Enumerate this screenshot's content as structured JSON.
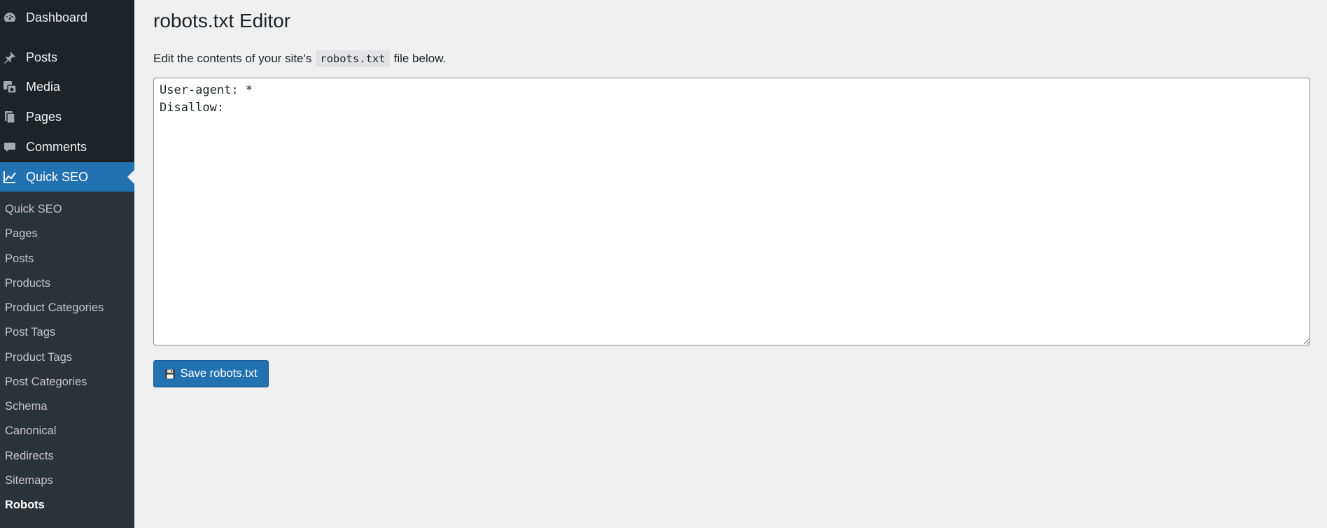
{
  "sidebar": {
    "menu": [
      {
        "label": "Dashboard",
        "icon": "dashboard-icon"
      },
      {
        "label": "Posts",
        "icon": "pin-icon"
      },
      {
        "label": "Media",
        "icon": "media-icon"
      },
      {
        "label": "Pages",
        "icon": "pages-icon"
      },
      {
        "label": "Comments",
        "icon": "comment-icon"
      },
      {
        "label": "Quick SEO",
        "icon": "chart-line-icon",
        "current": true
      }
    ],
    "submenu": [
      "Quick SEO",
      "Pages",
      "Posts",
      "Products",
      "Product Categories",
      "Post Tags",
      "Product Tags",
      "Post Categories",
      "Schema",
      "Canonical",
      "Redirects",
      "Sitemaps",
      "Robots"
    ],
    "active_submenu": "Robots"
  },
  "main": {
    "title": "robots.txt Editor",
    "description_before": "Edit the contents of your site's",
    "description_code": "robots.txt",
    "description_after": "file below.",
    "editor_content": "User-agent: *\nDisallow:",
    "save_button": {
      "label": "Save robots.txt",
      "icon": "floppy-disk-icon"
    }
  },
  "colors": {
    "sidebar_bg": "#1d2327",
    "submenu_bg": "#2c3338",
    "accent": "#2271b1",
    "page_bg": "#f0f0f1"
  }
}
